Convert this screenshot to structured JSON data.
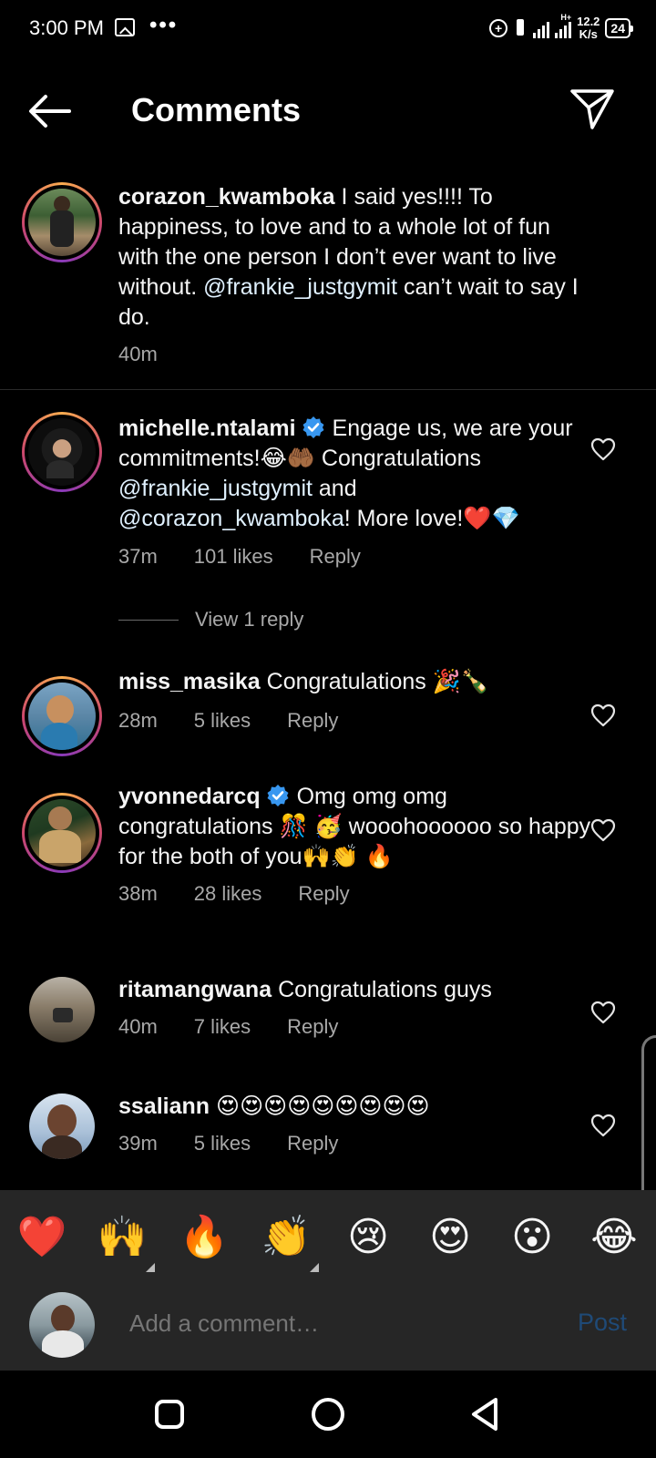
{
  "status_bar": {
    "time": "3:00 PM",
    "dots": "•••",
    "network_type": "H+",
    "speed_value": "12.2",
    "speed_unit": "K/s",
    "battery": "24"
  },
  "header": {
    "title": "Comments",
    "back_icon": "arrow-left-icon",
    "send_icon": "paper-plane-icon"
  },
  "caption": {
    "username": "corazon_kwamboka",
    "text_before": "I said yes!!!! To happiness, to love and to a whole lot of fun with the one person I don’t ever want to live without. ",
    "mention": "@frankie_justgymit",
    "text_after": " can’t wait to say I do.",
    "time": "40m"
  },
  "comments": [
    {
      "username": "michelle.ntalami",
      "verified": true,
      "text1": "Engage us, we are your commitments!",
      "emoji1": "😂🤲🏾",
      "text2": " Congratulations ",
      "mention1": "@frankie_justgymit",
      "text3": " and ",
      "mention2": "@corazon_kwamboka",
      "text4": "! More love!",
      "emoji2": "❤️💎",
      "time": "37m",
      "likes": "101 likes",
      "reply": "Reply",
      "view_replies": "View 1 reply"
    },
    {
      "username": "miss_masika",
      "text": "Congratulations",
      "emoji": "🎉🍾",
      "time": "28m",
      "likes": "5 likes",
      "reply": "Reply"
    },
    {
      "username": "yvonnedarcq",
      "verified": true,
      "text1": "Omg omg omg congratulations",
      "emoji1": "🎊 🥳",
      "text2": "wooooh000000",
      "text2_display": "wooohoooooo so happy for the both of you",
      "emoji2": "🙌👏 🔥",
      "time": "38m",
      "likes": "28 likes",
      "reply": "Reply"
    },
    {
      "username": "ritamangwana",
      "text": "Congratulations guys",
      "time": "40m",
      "likes": "7 likes",
      "reply": "Reply"
    },
    {
      "username": "ssaliann",
      "emoji": "😍😍😍😍😍😍😍😍😍",
      "time": "39m",
      "likes": "5 likes",
      "reply": "Reply"
    }
  ],
  "quick_emojis": [
    "❤️",
    "🙌",
    "🔥",
    "👏",
    "😢",
    "😍",
    "😮",
    "😂"
  ],
  "input": {
    "placeholder": "Add a comment…",
    "post_label": "Post"
  },
  "colors": {
    "background": "#000000",
    "panel": "#262626",
    "meta": "#a8a8a8",
    "post_disabled": "#1f4a77",
    "verified": "#3897f0"
  }
}
